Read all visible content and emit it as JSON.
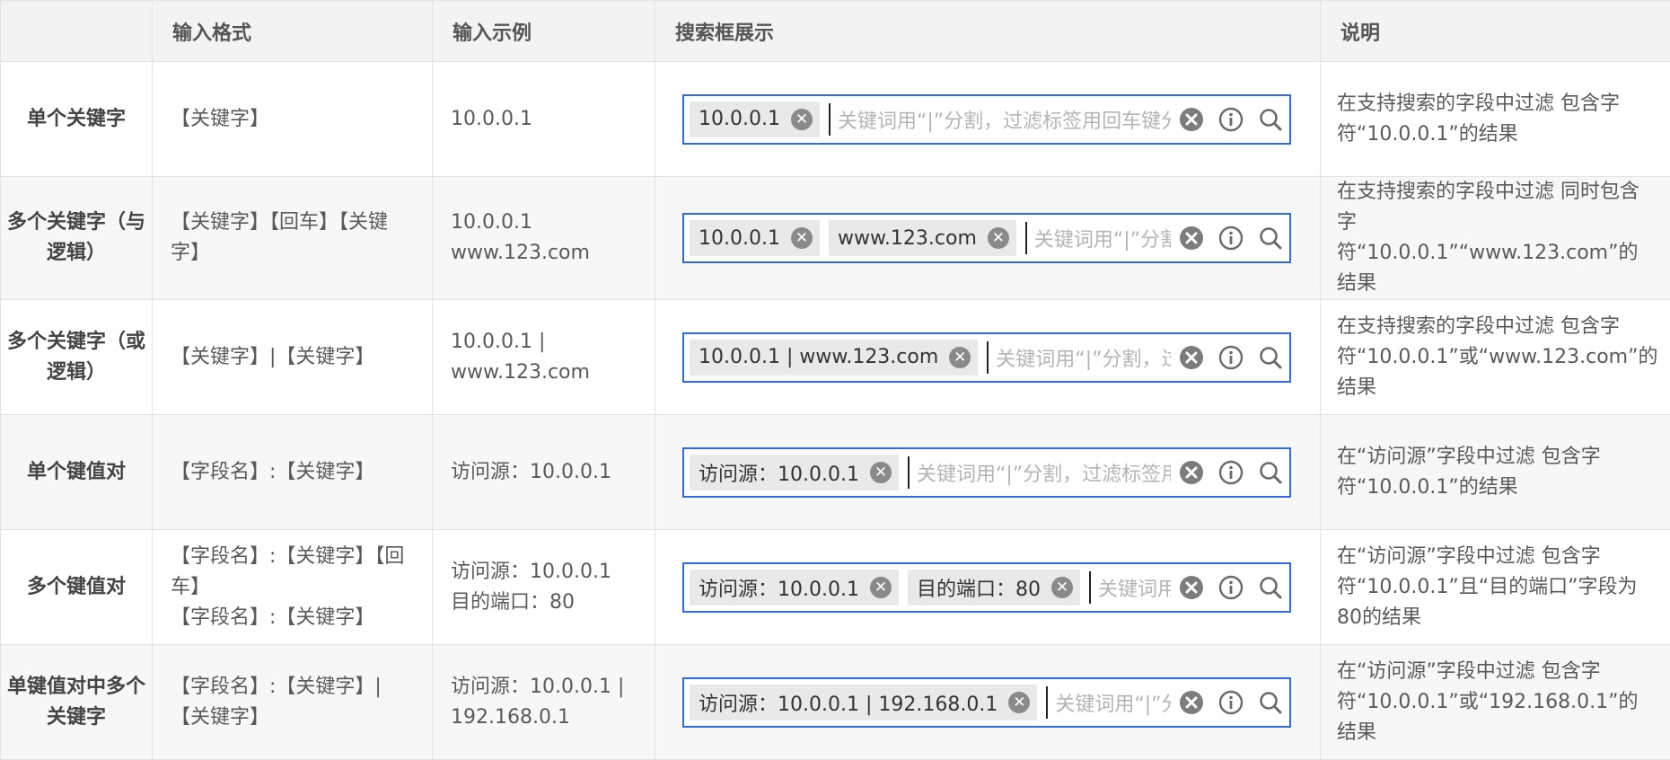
{
  "headers": [
    "",
    "输入格式",
    "输入示例",
    "搜索框展示",
    "说明"
  ],
  "placeholder": "关键词用“|”分割，过滤标签用回车键分隔",
  "icons": {
    "tag_clear": "close-circle-icon",
    "clear": "clear-circle-icon",
    "info": "info-icon",
    "search": "search-icon"
  },
  "colors": {
    "focus_border": "#2f6bdc",
    "tag_bg": "#e9e9e9",
    "header_bg": "#f3f3f3"
  },
  "rows": [
    {
      "name": "单个关键字",
      "format": "【关键字】",
      "example": "10.0.0.1",
      "tags": [
        "10.0.0.1"
      ],
      "desc": "在支持搜索的字段中过滤 包含字符“10.0.0.1”的结果"
    },
    {
      "name": "多个关键字（与逻辑）",
      "format": "【关键字】【回车】【关键字】",
      "example": "10.0.0.1\nwww.123.com",
      "tags": [
        "10.0.0.1",
        "www.123.com"
      ],
      "desc": "在支持搜索的字段中过滤 同时包含字符“10.0.0.1”“www.123.com”的结果"
    },
    {
      "name": "多个关键字（或逻辑）",
      "format": "【关键字】|【关键字】",
      "example": "10.0.0.1 | www.123.com",
      "tags": [
        "10.0.0.1 | www.123.com"
      ],
      "desc": "在支持搜索的字段中过滤 包含字符“10.0.0.1”或“www.123.com”的结果"
    },
    {
      "name": "单个键值对",
      "format": "【字段名】:【关键字】",
      "example": "访问源：10.0.0.1",
      "tags": [
        "访问源：10.0.0.1"
      ],
      "desc": "在“访问源”字段中过滤 包含字符“10.0.0.1”的结果"
    },
    {
      "name": "多个键值对",
      "format": "【字段名】:【关键字】【回车】\n【字段名】:【关键字】",
      "example": "访问源：10.0.0.1\n目的端口：80",
      "tags": [
        "访问源：10.0.0.1",
        "目的端口：80"
      ],
      "desc": "在“访问源”字段中过滤 包含字符“10.0.0.1”且“目的端口”字段为80的结果"
    },
    {
      "name": "单键值对中多个关键字",
      "format": "【字段名】:【关键字】|【关键字】",
      "example": "访问源：10.0.0.1 | 192.168.0.1",
      "tags": [
        "访问源：10.0.0.1 | 192.168.0.1"
      ],
      "desc": "在“访问源”字段中过滤 包含字符“10.0.0.1”或“192.168.0.1”的结果"
    }
  ]
}
